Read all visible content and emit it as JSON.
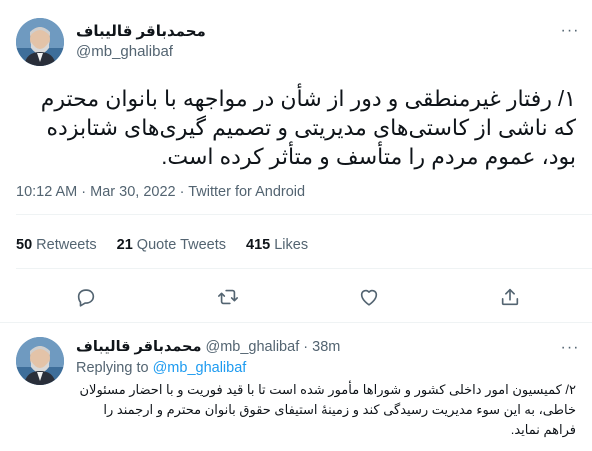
{
  "main_tweet": {
    "display_name": "محمدباقر قالیباف",
    "handle": "@mb_ghalibaf",
    "more_label": "···",
    "text": "۱/ رفتار غیرمنطقی و دور از شأن در مواجهه با بانوان محترم که ناشی از کاستی‌های مدیریتی و تصمیم گیری‌های شتابزده بود، عموم مردم را متأسف و متأثر کرده است.",
    "time": "10:12 AM",
    "separator": " · ",
    "date": "Mar 30, 2022",
    "source": "Twitter for Android",
    "stats": {
      "retweets_count": "50",
      "retweets_label": "Retweets",
      "quotes_count": "21",
      "quotes_label": "Quote Tweets",
      "likes_count": "415",
      "likes_label": "Likes"
    },
    "icons": [
      "reply-icon",
      "retweet-icon",
      "like-icon",
      "share-icon"
    ]
  },
  "reply_tweet": {
    "display_name": "محمدباقر قالیباف",
    "handle": "@mb_ghalibaf",
    "time_ago": "38m",
    "dot": " · ",
    "more_label": "···",
    "replying_to_label": "Replying to",
    "replying_to_handle": "@mb_ghalibaf",
    "text": "۲/ کمیسیون امور داخلی کشور و شوراها مأمور شده است تا با قید فوریت و با احضار مسئولان خاطی، به این سوء مدیریت رسیدگی کند و زمینۀ استیفای حقوق بانوان محترم و ارجمند را فراهم نماید."
  },
  "colors": {
    "text_primary": "#0f1419",
    "text_secondary": "#536471",
    "link": "#1d9bf0",
    "divider": "#eff3f4"
  }
}
